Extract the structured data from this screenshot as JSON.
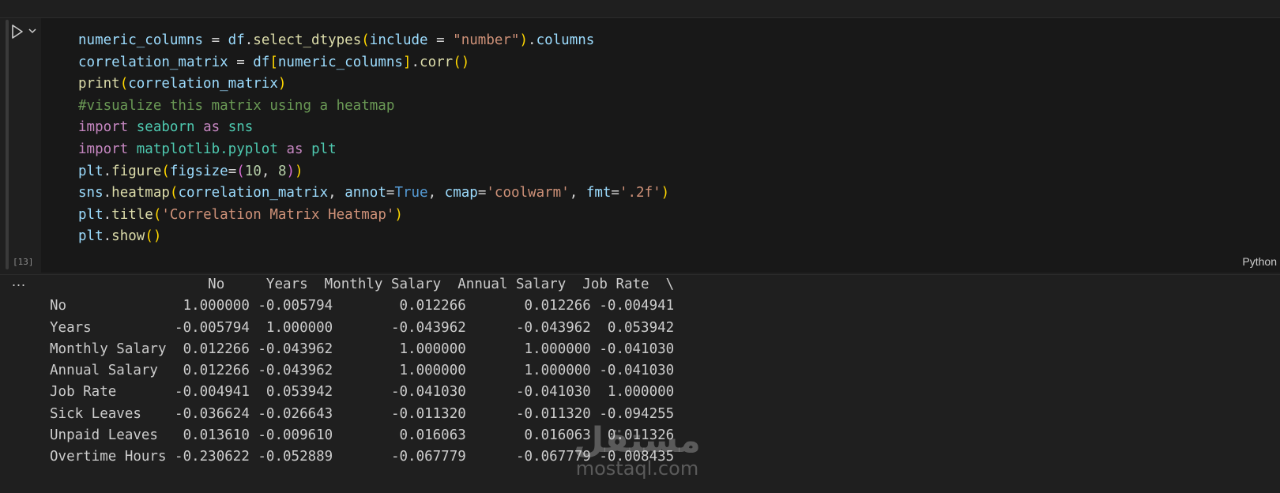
{
  "cell": {
    "execution_count": "[13]",
    "language": "Python",
    "run_icon": "play-icon",
    "chevron_icon": "chevron-down-icon",
    "code_lines": [
      [
        [
          "var",
          "numeric_columns"
        ],
        [
          "op",
          " = "
        ],
        [
          "var",
          "df"
        ],
        [
          "op",
          "."
        ],
        [
          "fn",
          "select_dtypes"
        ],
        [
          "b1",
          "("
        ],
        [
          "var",
          "include"
        ],
        [
          "op",
          " = "
        ],
        [
          "str",
          "\"number\""
        ],
        [
          "b1",
          ")"
        ],
        [
          "op",
          "."
        ],
        [
          "var",
          "columns"
        ]
      ],
      [
        [
          "var",
          "correlation_matrix"
        ],
        [
          "op",
          " = "
        ],
        [
          "var",
          "df"
        ],
        [
          "b1",
          "["
        ],
        [
          "var",
          "numeric_columns"
        ],
        [
          "b1",
          "]"
        ],
        [
          "op",
          "."
        ],
        [
          "fn",
          "corr"
        ],
        [
          "b1",
          "()"
        ]
      ],
      [
        [
          "fn",
          "print"
        ],
        [
          "b1",
          "("
        ],
        [
          "var",
          "correlation_matrix"
        ],
        [
          "b1",
          ")"
        ]
      ],
      [
        [
          "com",
          "#visualize this matrix using a heatmap"
        ]
      ],
      [
        [
          "kw",
          "import"
        ],
        [
          "op",
          " "
        ],
        [
          "mod",
          "seaborn"
        ],
        [
          "op",
          " "
        ],
        [
          "kw",
          "as"
        ],
        [
          "op",
          " "
        ],
        [
          "mod",
          "sns"
        ]
      ],
      [
        [
          "kw",
          "import"
        ],
        [
          "op",
          " "
        ],
        [
          "mod",
          "matplotlib.pyplot"
        ],
        [
          "op",
          " "
        ],
        [
          "kw",
          "as"
        ],
        [
          "op",
          " "
        ],
        [
          "mod",
          "plt"
        ]
      ],
      [
        [
          "var",
          "plt"
        ],
        [
          "op",
          "."
        ],
        [
          "fn",
          "figure"
        ],
        [
          "b1",
          "("
        ],
        [
          "var",
          "figsize"
        ],
        [
          "op",
          "="
        ],
        [
          "b2",
          "("
        ],
        [
          "num",
          "10"
        ],
        [
          "op",
          ", "
        ],
        [
          "num",
          "8"
        ],
        [
          "b2",
          ")"
        ],
        [
          "b1",
          ")"
        ]
      ],
      [
        [
          "var",
          "sns"
        ],
        [
          "op",
          "."
        ],
        [
          "fn",
          "heatmap"
        ],
        [
          "b1",
          "("
        ],
        [
          "var",
          "correlation_matrix"
        ],
        [
          "op",
          ", "
        ],
        [
          "var",
          "annot"
        ],
        [
          "op",
          "="
        ],
        [
          "bool",
          "True"
        ],
        [
          "op",
          ", "
        ],
        [
          "var",
          "cmap"
        ],
        [
          "op",
          "="
        ],
        [
          "str",
          "'coolwarm'"
        ],
        [
          "op",
          ", "
        ],
        [
          "var",
          "fmt"
        ],
        [
          "op",
          "="
        ],
        [
          "str",
          "'.2f'"
        ],
        [
          "b1",
          ")"
        ]
      ],
      [
        [
          "var",
          "plt"
        ],
        [
          "op",
          "."
        ],
        [
          "fn",
          "title"
        ],
        [
          "b1",
          "("
        ],
        [
          "str",
          "'Correlation Matrix Heatmap'"
        ],
        [
          "b1",
          ")"
        ]
      ],
      [
        [
          "var",
          "plt"
        ],
        [
          "op",
          "."
        ],
        [
          "fn",
          "show"
        ],
        [
          "b1",
          "()"
        ]
      ]
    ]
  },
  "output": {
    "menu_label": "...",
    "lines": [
      "                   No     Years  Monthly Salary  Annual Salary  Job Rate  \\",
      "No              1.000000 -0.005794        0.012266       0.012266 -0.004941",
      "Years          -0.005794  1.000000       -0.043962      -0.043962  0.053942",
      "Monthly Salary  0.012266 -0.043962        1.000000       1.000000 -0.041030",
      "Annual Salary   0.012266 -0.043962        1.000000       1.000000 -0.041030",
      "Job Rate       -0.004941  0.053942       -0.041030      -0.041030  1.000000",
      "Sick Leaves    -0.036624 -0.026643       -0.011320      -0.011320 -0.094255",
      "Unpaid Leaves   0.013610 -0.009610        0.016063       0.016063  0.011326",
      "Overtime Hours -0.230622 -0.052889       -0.067779      -0.067779 -0.008435"
    ]
  },
  "watermark": {
    "arabic": "مستقل",
    "latin": "mostaql.com"
  },
  "colors": {
    "background": "#1f1f1f",
    "editor": "#181818",
    "variable": "#9cdcfe",
    "function": "#dcdcaa",
    "string": "#ce9178",
    "keyword": "#c586c0",
    "module": "#4ec9b0",
    "comment": "#6a9955"
  }
}
